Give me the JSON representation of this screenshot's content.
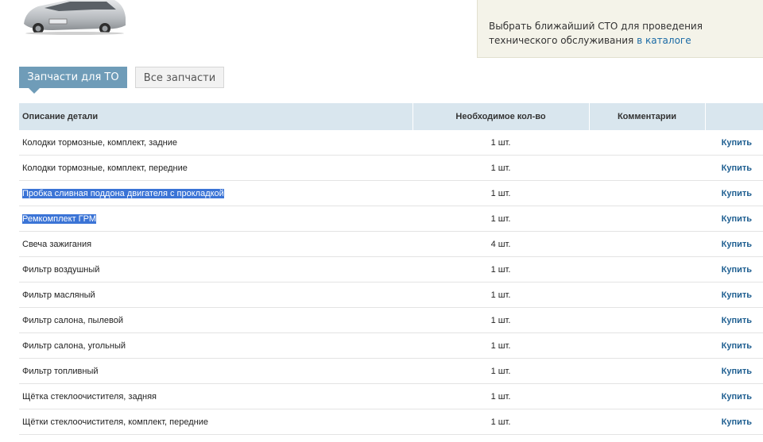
{
  "info": {
    "text_before_link": "Выбрать ближайший СТО для проведения технического обслуживания ",
    "link_text": "в каталоге"
  },
  "tabs": [
    {
      "label": "Запчасти для ТО",
      "active": true
    },
    {
      "label": "Все запчасти",
      "active": false
    }
  ],
  "table": {
    "headers": {
      "description": "Описание детали",
      "quantity": "Необходимое кол-во",
      "comments": "Комментарии",
      "action": ""
    },
    "rows": [
      {
        "description": "Колодки тормозные, комплект, задние",
        "quantity": "1 шт.",
        "comment": "",
        "buy": "Купить",
        "selected": false
      },
      {
        "description": "Колодки тормозные, комплект, передние",
        "quantity": "1 шт.",
        "comment": "",
        "buy": "Купить",
        "selected": false
      },
      {
        "description": "Пробка сливная поддона двигателя с прокладкой",
        "quantity": "1 шт.",
        "comment": "",
        "buy": "Купить",
        "selected": true
      },
      {
        "description": "Ремкомплект ГРМ",
        "quantity": "1 шт.",
        "comment": "",
        "buy": "Купить",
        "selected": true
      },
      {
        "description": "Свеча зажигания",
        "quantity": "4 шт.",
        "comment": "",
        "buy": "Купить",
        "selected": false
      },
      {
        "description": "Фильтр воздушный",
        "quantity": "1 шт.",
        "comment": "",
        "buy": "Купить",
        "selected": false
      },
      {
        "description": "Фильтр масляный",
        "quantity": "1 шт.",
        "comment": "",
        "buy": "Купить",
        "selected": false
      },
      {
        "description": "Фильтр салона, пылевой",
        "quantity": "1 шт.",
        "comment": "",
        "buy": "Купить",
        "selected": false
      },
      {
        "description": "Фильтр салона, угольный",
        "quantity": "1 шт.",
        "comment": "",
        "buy": "Купить",
        "selected": false
      },
      {
        "description": "Фильтр топливный",
        "quantity": "1 шт.",
        "comment": "",
        "buy": "Купить",
        "selected": false
      },
      {
        "description": "Щётка стеклоочистителя, задняя",
        "quantity": "1 шт.",
        "comment": "",
        "buy": "Купить",
        "selected": false
      },
      {
        "description": "Щётки стеклоочистителя, комплект, передние",
        "quantity": "1 шт.",
        "comment": "",
        "buy": "Купить",
        "selected": false
      }
    ]
  },
  "colors": {
    "tab_active": "#6f9cb8",
    "header_bg": "#d9e6ee",
    "link": "#1f5f91",
    "selection": "#3b74d6"
  }
}
